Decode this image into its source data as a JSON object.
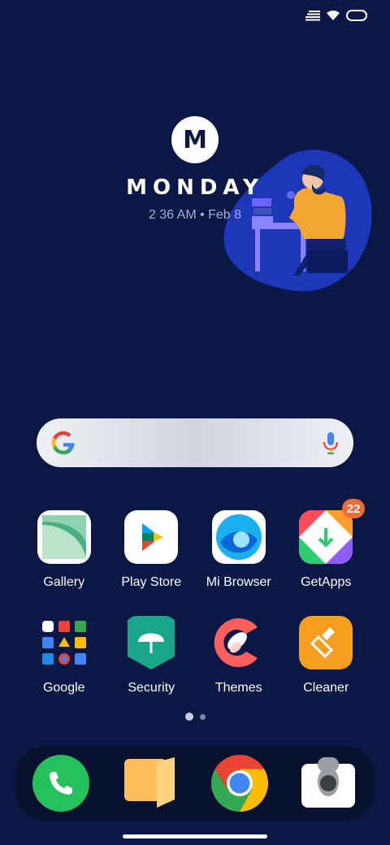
{
  "status_bar": {
    "icons": [
      "signal-icon",
      "wifi-icon",
      "battery-icon"
    ]
  },
  "widget": {
    "logo_letter": "M",
    "day": "MONDAY",
    "datetime": "2 36 AM • Feb 8"
  },
  "search": {
    "icons": [
      "google-g-icon",
      "microphone-icon"
    ]
  },
  "apps": [
    {
      "label": "Gallery"
    },
    {
      "label": "Play Store"
    },
    {
      "label": "Mi Browser"
    },
    {
      "label": "GetApps",
      "badge": "22"
    },
    {
      "label": "Google"
    },
    {
      "label": "Security"
    },
    {
      "label": "Themes"
    },
    {
      "label": "Cleaner"
    }
  ],
  "page_indicator": {
    "pages": 2,
    "current": 1
  },
  "dock": {
    "apps": [
      "phone",
      "notes",
      "chrome",
      "camera"
    ]
  },
  "colors": {
    "background": "#0b1744",
    "badge": "#f26a35",
    "blob": "#1d37b8"
  }
}
